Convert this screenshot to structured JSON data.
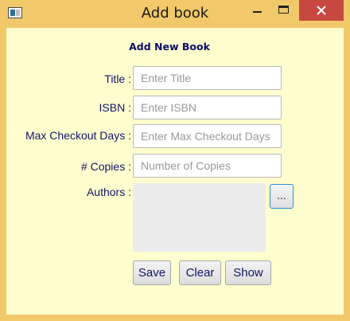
{
  "window": {
    "title": "Add book"
  },
  "form": {
    "heading": "Add New Book",
    "title_label": "Title :",
    "title_placeholder": "Enter Title",
    "isbn_label": "ISBN :",
    "isbn_placeholder": "Enter ISBN",
    "max_checkout_label": "Max Checkout Days :",
    "max_checkout_placeholder": "Enter Max Checkout Days",
    "copies_label": "# Copies :",
    "copies_placeholder": "Number of Copies",
    "authors_label": "Authors :",
    "browse_label": "...",
    "buttons": {
      "save": "Save",
      "clear": "Clear",
      "show": "Show"
    }
  },
  "colors": {
    "window_frame": "#f1c86a",
    "client_background": "#fffece",
    "label_text": "#14146b",
    "close_button": "#c7483f"
  }
}
